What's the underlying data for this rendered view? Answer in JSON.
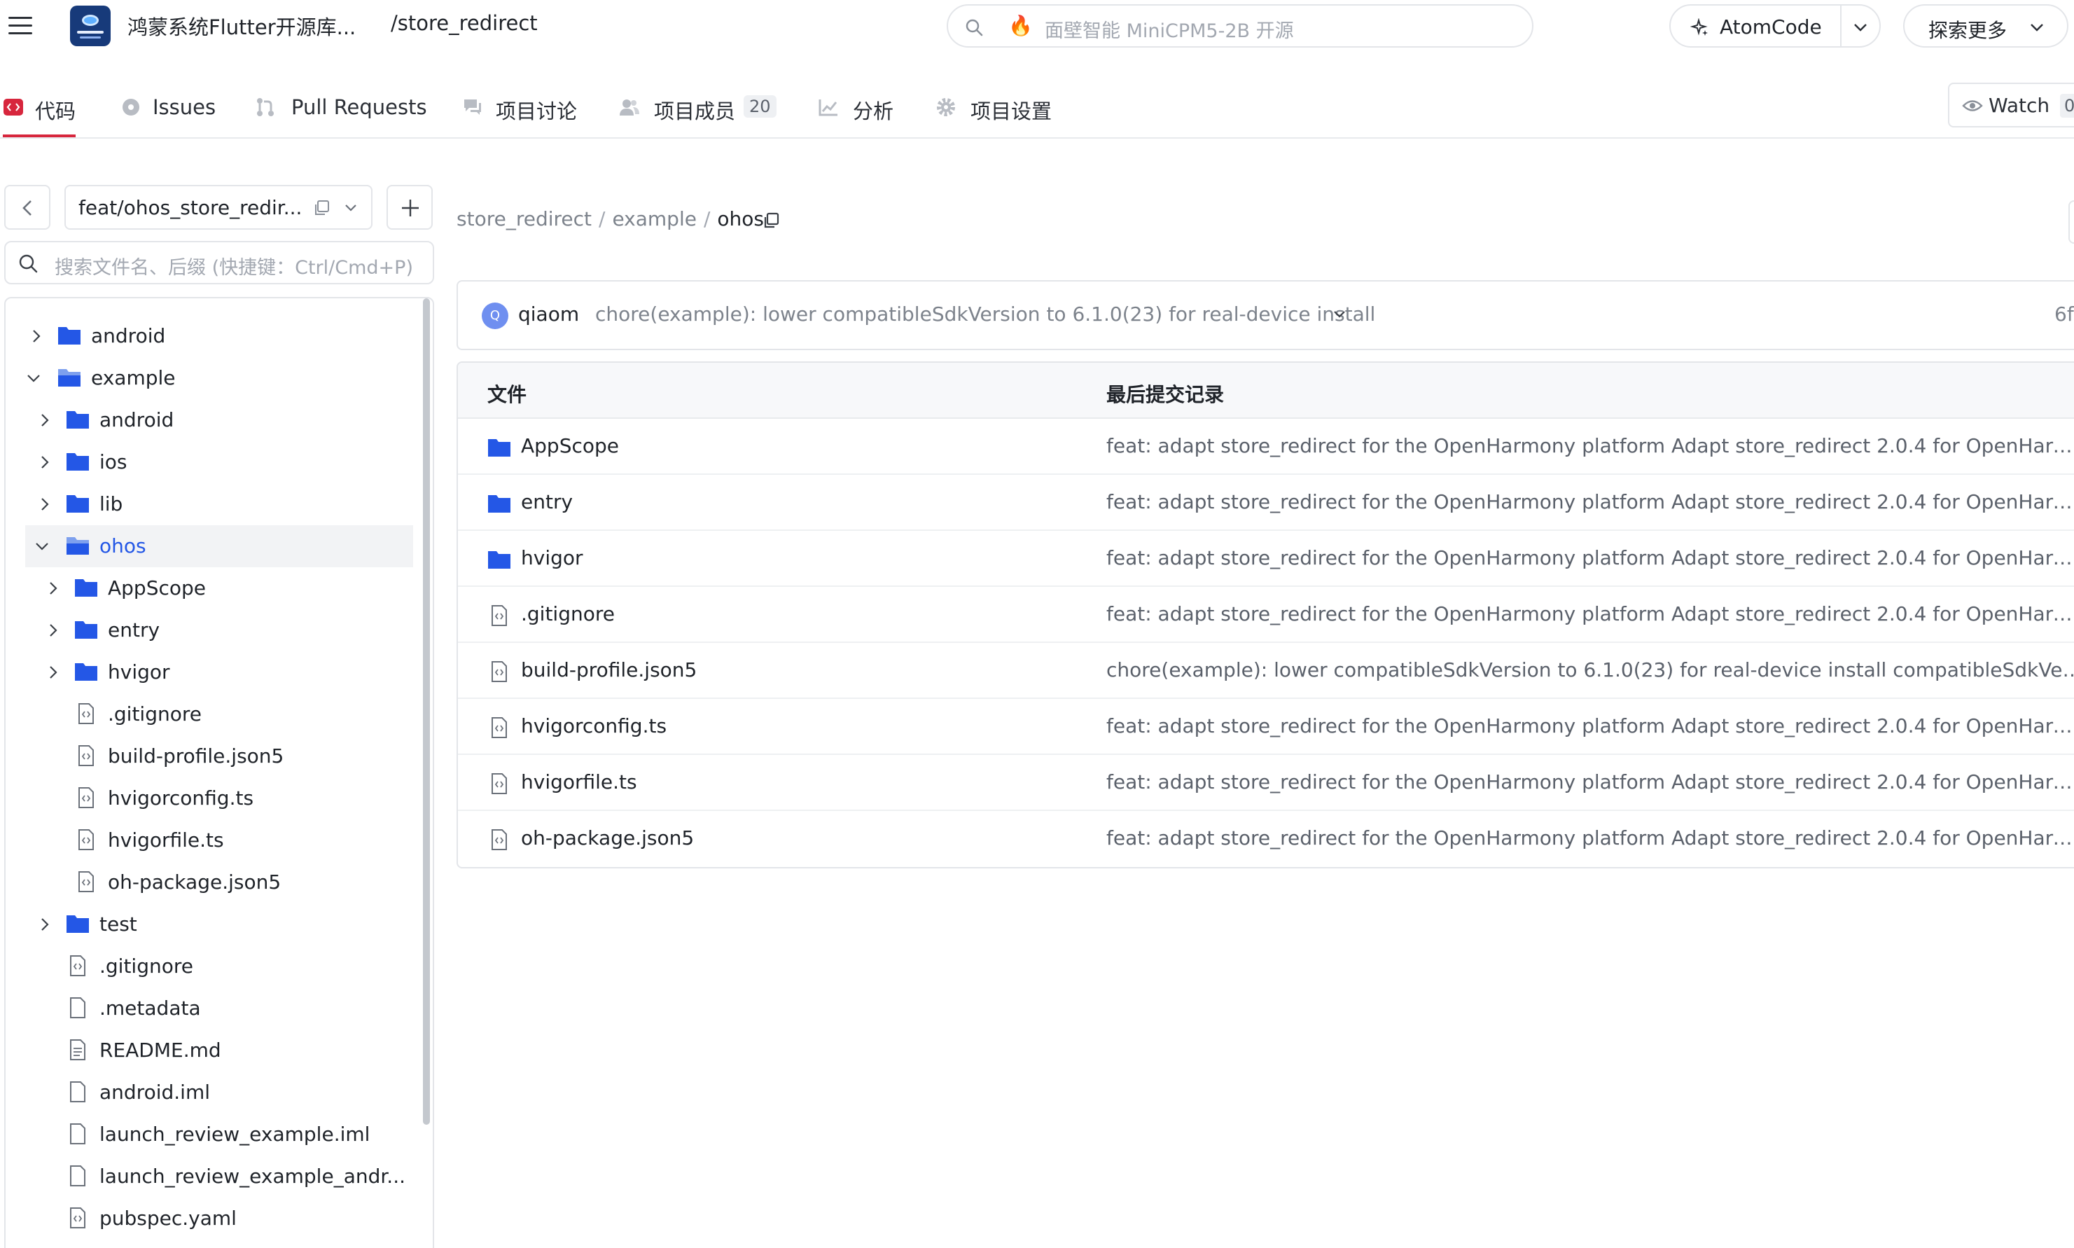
{
  "header": {
    "repo_org": "鸿蒙系统Flutter开源库...",
    "repo_name": "/store_redirect",
    "search_placeholder": "面壁智能 MiniCPM5-2B 开源",
    "atom_label": "AtomCode",
    "explore_label": "探索更多"
  },
  "tabs": [
    {
      "label": "代码",
      "icon": "code-icon"
    },
    {
      "label": "Issues",
      "icon": "issues-icon"
    },
    {
      "label": "Pull Requests",
      "icon": "pull-request-icon"
    },
    {
      "label": "项目讨论",
      "icon": "discussion-icon"
    },
    {
      "label": "项目成员",
      "icon": "members-icon",
      "badge": "20"
    },
    {
      "label": "分析",
      "icon": "analytics-icon"
    },
    {
      "label": "项目设置",
      "icon": "settings-icon"
    }
  ],
  "watch": {
    "label": "Watch",
    "count": "0"
  },
  "sidebar": {
    "branch": "feat/ohos_store_redir...",
    "search_placeholder": "搜索文件名、后缀 (快捷键：Ctrl/Cmd+P)",
    "tree": [
      {
        "label": "android",
        "type": "folder",
        "expanded": false
      },
      {
        "label": "example",
        "type": "folder",
        "expanded": true
      },
      {
        "label": "android",
        "type": "folder",
        "expanded": false
      },
      {
        "label": "ios",
        "type": "folder",
        "expanded": false
      },
      {
        "label": "lib",
        "type": "folder",
        "expanded": false
      },
      {
        "label": "ohos",
        "type": "folder",
        "expanded": true,
        "selected": true
      },
      {
        "label": "AppScope",
        "type": "folder",
        "expanded": false
      },
      {
        "label": "entry",
        "type": "folder",
        "expanded": false
      },
      {
        "label": "hvigor",
        "type": "folder",
        "expanded": false
      },
      {
        "label": ".gitignore",
        "type": "code-file"
      },
      {
        "label": "build-profile.json5",
        "type": "code-file"
      },
      {
        "label": "hvigorconfig.ts",
        "type": "code-file"
      },
      {
        "label": "hvigorfile.ts",
        "type": "code-file"
      },
      {
        "label": "oh-package.json5",
        "type": "code-file"
      },
      {
        "label": "test",
        "type": "folder",
        "expanded": false
      },
      {
        "label": ".gitignore",
        "type": "code-file"
      },
      {
        "label": ".metadata",
        "type": "file"
      },
      {
        "label": "README.md",
        "type": "doc-file"
      },
      {
        "label": "android.iml",
        "type": "file"
      },
      {
        "label": "launch_review_example.iml",
        "type": "file"
      },
      {
        "label": "launch_review_example_andr...",
        "type": "file"
      },
      {
        "label": "pubspec.yaml",
        "type": "code-file"
      }
    ]
  },
  "breadcrumb": {
    "items": [
      "store_redirect",
      "example"
    ],
    "separator": "/",
    "current": "ohos"
  },
  "latest_commit": {
    "avatar": "Q",
    "author": "qiaom",
    "message": "chore(example): lower compatibleSdkVersion to 6.1.0(23) for real-device install",
    "hash": "6f"
  },
  "file_table": {
    "col_file": "文件",
    "col_commit": "最后提交记录",
    "rows": [
      {
        "name": "AppScope",
        "type": "folder",
        "message": "feat: adapt store_redirect for the OpenHarmony platform Adapt store_redirect 2.0.4 for OpenHarmony /..."
      },
      {
        "name": "entry",
        "type": "folder",
        "message": "feat: adapt store_redirect for the OpenHarmony platform Adapt store_redirect 2.0.4 for OpenHarmony /..."
      },
      {
        "name": "hvigor",
        "type": "folder",
        "message": "feat: adapt store_redirect for the OpenHarmony platform Adapt store_redirect 2.0.4 for OpenHarmony /..."
      },
      {
        "name": ".gitignore",
        "type": "code-file",
        "message": "feat: adapt store_redirect for the OpenHarmony platform Adapt store_redirect 2.0.4 for OpenHarmony /..."
      },
      {
        "name": "build-profile.json5",
        "type": "code-file",
        "message": "chore(example): lower compatibleSdkVersion to 6.1.0(23) for real-device install compatibleSdkVersion m..."
      },
      {
        "name": "hvigorconfig.ts",
        "type": "code-file",
        "message": "feat: adapt store_redirect for the OpenHarmony platform Adapt store_redirect 2.0.4 for OpenHarmony /..."
      },
      {
        "name": "hvigorfile.ts",
        "type": "code-file",
        "message": "feat: adapt store_redirect for the OpenHarmony platform Adapt store_redirect 2.0.4 for OpenHarmony /..."
      },
      {
        "name": "oh-package.json5",
        "type": "code-file",
        "message": "feat: adapt store_redirect for the OpenHarmony platform Adapt store_redirect 2.0.4 for OpenHarmony /..."
      }
    ]
  },
  "colors": {
    "accent": "#d7263d",
    "folder": "#2457e6",
    "link": "#2457e6",
    "border": "#e3e5e9"
  }
}
